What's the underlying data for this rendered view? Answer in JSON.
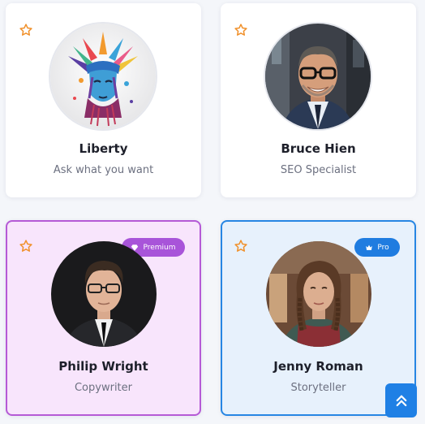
{
  "cards": [
    {
      "name": "Liberty",
      "role": "Ask what you want",
      "favorite_icon": "star-outline-icon",
      "avatar": "statue-of-liberty-avatar"
    },
    {
      "name": "Bruce Hien",
      "role": "SEO Specialist",
      "favorite_icon": "star-outline-icon",
      "avatar": "smiling-man-glasses-avatar"
    },
    {
      "name": "Philip Wright",
      "role": "Copywriter",
      "favorite_icon": "star-outline-icon",
      "avatar": "young-man-suit-avatar",
      "badge": {
        "label": "Premium",
        "icon": "diamond-icon",
        "color": "#a854d9"
      }
    },
    {
      "name": "Jenny Roman",
      "role": "Storyteller",
      "favorite_icon": "star-outline-icon",
      "avatar": "woman-braids-avatar",
      "badge": {
        "label": "Pro",
        "icon": "crown-icon",
        "color": "#1f7ce0"
      }
    }
  ],
  "colors": {
    "star": "#f0902a",
    "premium_border": "#b55ad6",
    "premium_bg": "#f8e5fc",
    "pro_border": "#2786e3",
    "pro_bg": "#e7f1fc",
    "scroll_button": "#1f80e5"
  },
  "scroll_top_icon": "double-chevron-up-icon"
}
